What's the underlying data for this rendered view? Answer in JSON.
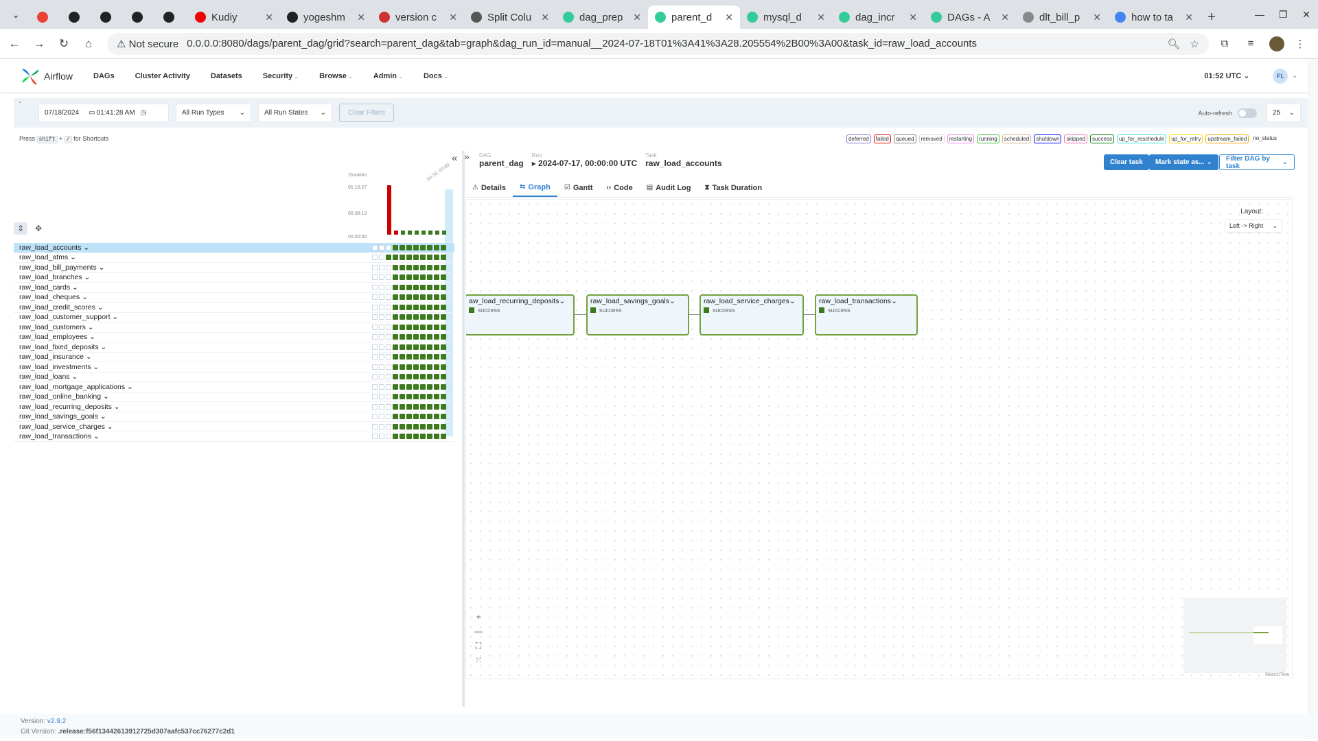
{
  "browser": {
    "tabs": [
      {
        "title": "",
        "color": "#ea4335",
        "icon": "gmail-icon"
      },
      {
        "title": "",
        "color": "#222",
        "icon": "github-icon"
      },
      {
        "title": "",
        "color": "#222",
        "icon": "github-icon"
      },
      {
        "title": "",
        "color": "#222",
        "icon": "github-icon"
      },
      {
        "title": "",
        "color": "#222",
        "icon": "github-icon"
      },
      {
        "title": "Kudiy",
        "color": "#e00",
        "icon": "youtube-icon"
      },
      {
        "title": "yogeshm",
        "color": "#222",
        "icon": "github-icon"
      },
      {
        "title": "version c",
        "color": "#c33",
        "icon": "git-icon"
      },
      {
        "title": "Split Colu",
        "color": "#555",
        "icon": "chatgpt-icon"
      },
      {
        "title": "dag_prep",
        "color": "#3c9",
        "icon": "airflow-icon"
      },
      {
        "title": "parent_d",
        "color": "#3c9",
        "icon": "airflow-icon"
      },
      {
        "title": "mysql_d",
        "color": "#3c9",
        "icon": "airflow-icon"
      },
      {
        "title": "dag_incr",
        "color": "#3c9",
        "icon": "airflow-icon"
      },
      {
        "title": "DAGs - A",
        "color": "#3c9",
        "icon": "airflow-icon"
      },
      {
        "title": "dlt_bill_p",
        "color": "#888",
        "icon": "globe-icon"
      },
      {
        "title": "how to ta",
        "color": "#4285f4",
        "icon": "google-icon"
      }
    ],
    "active_tab_index": 10,
    "not_secure": "Not secure",
    "url": "0.0.0.0:8080/dags/parent_dag/grid?search=parent_dag&tab=graph&dag_run_id=manual__2024-07-18T01%3A41%3A28.205554%2B00%3A00&task_id=raw_load_accounts"
  },
  "nav": {
    "logo": "Airflow",
    "items": [
      "DAGs",
      "Cluster Activity",
      "Datasets",
      "Security",
      "Browse",
      "Admin",
      "Docs"
    ],
    "time": "01:52 UTC",
    "avatar": "FL"
  },
  "filters": {
    "date": "07/18/2024",
    "time": "01:41:28 AM",
    "run_types": "All Run Types",
    "run_states": "All Run States",
    "clear": "Clear Filters",
    "autorefresh": "Auto-refresh",
    "page_size": "25"
  },
  "shortcut": {
    "press": "Press",
    "key1": "shift",
    "plus": "+",
    "key2": "/",
    "suffix": "for Shortcuts"
  },
  "legend": [
    {
      "label": "deferred",
      "color": "#9370db"
    },
    {
      "label": "failed",
      "color": "#e00"
    },
    {
      "label": "queued",
      "color": "#808080"
    },
    {
      "label": "removed",
      "color": "#d3d3d3"
    },
    {
      "label": "restarting",
      "color": "#ee82ee"
    },
    {
      "label": "running",
      "color": "#32cd32"
    },
    {
      "label": "scheduled",
      "color": "#d2b48c"
    },
    {
      "label": "shutdown",
      "color": "#0000ff"
    },
    {
      "label": "skipped",
      "color": "#ff69b4"
    },
    {
      "label": "success",
      "color": "#008000"
    },
    {
      "label": "up_for_reschedule",
      "color": "#40e0d0"
    },
    {
      "label": "up_for_retry",
      "color": "#ffd700"
    },
    {
      "label": "upstream_failed",
      "color": "#ffa500"
    },
    {
      "label": "no_status",
      "color": "#fff"
    }
  ],
  "grid": {
    "duration_label": "Duration",
    "ticks": [
      "01:16:27",
      "00:38:13",
      "00:00:00"
    ],
    "date_label": "Jul 18, 00:00",
    "tasks": [
      {
        "name": "raw_load_accounts",
        "selected": true
      },
      {
        "name": "raw_load_atms",
        "selected": false
      },
      {
        "name": "raw_load_bill_payments",
        "selected": false
      },
      {
        "name": "raw_load_branches",
        "selected": false
      },
      {
        "name": "raw_load_cards",
        "selected": false
      },
      {
        "name": "raw_load_cheques",
        "selected": false
      },
      {
        "name": "raw_load_credit_scores",
        "selected": false
      },
      {
        "name": "raw_load_customer_support",
        "selected": false
      },
      {
        "name": "raw_load_customers",
        "selected": false
      },
      {
        "name": "raw_load_employees",
        "selected": false
      },
      {
        "name": "raw_load_fixed_deposits",
        "selected": false
      },
      {
        "name": "raw_load_insurance",
        "selected": false
      },
      {
        "name": "raw_load_investments",
        "selected": false
      },
      {
        "name": "raw_load_loans",
        "selected": false
      },
      {
        "name": "raw_load_mortgage_applications",
        "selected": false
      },
      {
        "name": "raw_load_online_banking",
        "selected": false
      },
      {
        "name": "raw_load_recurring_deposits",
        "selected": false
      },
      {
        "name": "raw_load_savings_goals",
        "selected": false
      },
      {
        "name": "raw_load_service_charges",
        "selected": false
      },
      {
        "name": "raw_load_transactions",
        "selected": false
      }
    ]
  },
  "detail": {
    "crumbs": [
      {
        "label": "DAG",
        "value": "parent_dag"
      },
      {
        "label": "Run",
        "value": "▸ 2024-07-17, 00:00:00 UTC"
      },
      {
        "label": "Task",
        "value": "raw_load_accounts"
      }
    ],
    "buttons": {
      "clear": "Clear task",
      "mark": "Mark state as...",
      "filter": "Filter DAG by task"
    },
    "tabs": [
      "Details",
      "Graph",
      "Gantt",
      "Code",
      "Audit Log",
      "Task Duration"
    ],
    "active_tab": "Graph",
    "layout_label": "Layout:",
    "layout_value": "Left -> Right",
    "nodes": [
      {
        "name": "aw_load_recurring_deposits",
        "status": "success"
      },
      {
        "name": "raw_load_savings_goals",
        "status": "success"
      },
      {
        "name": "raw_load_service_charges",
        "status": "success"
      },
      {
        "name": "raw_load_transactions",
        "status": "success"
      }
    ],
    "reactflow": "React Flow"
  },
  "footer": {
    "version_label": "Version:",
    "version": "v2.9.2",
    "git_label": "Git Version:",
    "git": ".release:f56f13442613912725d307aafc537cc76277c2d1"
  }
}
